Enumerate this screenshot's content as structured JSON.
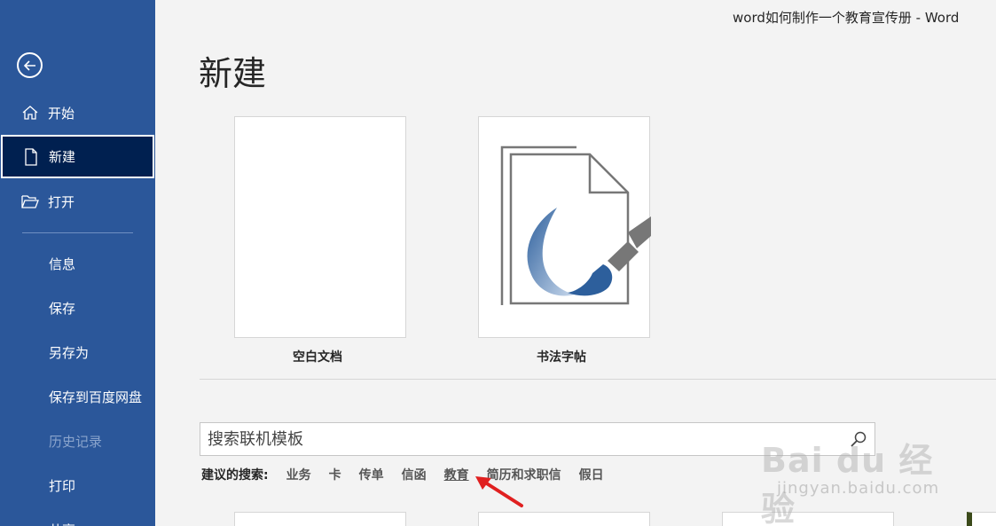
{
  "window": {
    "title": "word如何制作一个教育宣传册  -  Word"
  },
  "sidebar": {
    "items": [
      {
        "label": "开始",
        "icon": "home-icon"
      },
      {
        "label": "新建",
        "icon": "new-document-icon",
        "active": true
      },
      {
        "label": "打开",
        "icon": "folder-open-icon"
      },
      {
        "label": "信息"
      },
      {
        "label": "保存"
      },
      {
        "label": "另存为"
      },
      {
        "label": "保存到百度网盘"
      },
      {
        "label": "历史记录",
        "disabled": true
      },
      {
        "label": "打印"
      },
      {
        "label": "共享"
      }
    ]
  },
  "main": {
    "title": "新建",
    "templates": [
      {
        "name": "空白文档"
      },
      {
        "name": "书法字帖"
      }
    ],
    "search": {
      "placeholder": "搜索联机模板"
    },
    "suggested": {
      "label": "建议的搜索:",
      "links": [
        "业务",
        "卡",
        "传单",
        "信函",
        "教育",
        "简历和求职信",
        "假日"
      ]
    }
  },
  "watermark": {
    "brand": "Bai du 经验",
    "sub": "jingyan.baidu.com"
  },
  "colors": {
    "sidebar": "#2b579a",
    "active": "#002050",
    "annotation": "#e02020"
  }
}
